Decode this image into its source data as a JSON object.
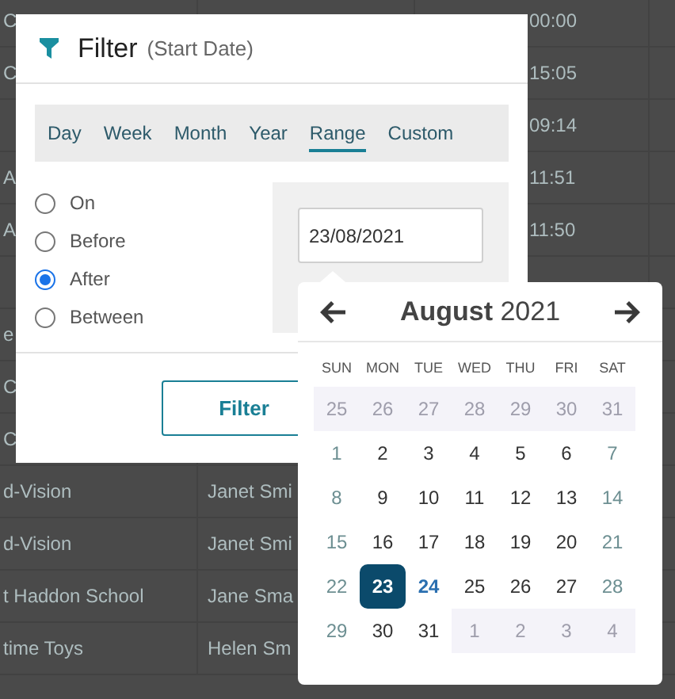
{
  "table": {
    "rows": [
      {
        "cells": [
          "C",
          "",
          "00:00"
        ]
      },
      {
        "cells": [
          "C",
          "",
          "15:05"
        ]
      },
      {
        "cells": [
          "",
          "",
          "09:14"
        ]
      },
      {
        "cells": [
          "A",
          "",
          "11:51"
        ]
      },
      {
        "cells": [
          "A",
          "",
          "11:50"
        ]
      },
      {
        "cells": [
          "",
          "",
          ""
        ]
      },
      {
        "cells": [
          "e",
          "",
          ""
        ]
      },
      {
        "cells": [
          "C",
          "",
          ""
        ]
      },
      {
        "cells": [
          "C",
          "",
          ""
        ]
      },
      {
        "cells": [
          "d-Vision",
          "Janet Smi",
          ""
        ]
      },
      {
        "cells": [
          "d-Vision",
          "Janet Smi",
          ""
        ]
      },
      {
        "cells": [
          "t Haddon School",
          "Jane Sma",
          ""
        ]
      },
      {
        "cells": [
          "time Toys",
          "Helen Sm",
          ""
        ]
      }
    ]
  },
  "dialog": {
    "title": "Filter",
    "subtitle": "(Start Date)",
    "tabs": [
      {
        "label": "Day",
        "selected": false
      },
      {
        "label": "Week",
        "selected": false
      },
      {
        "label": "Month",
        "selected": false
      },
      {
        "label": "Year",
        "selected": false
      },
      {
        "label": "Range",
        "selected": true
      },
      {
        "label": "Custom",
        "selected": false
      }
    ],
    "options": [
      {
        "label": "On",
        "selected": false
      },
      {
        "label": "Before",
        "selected": false
      },
      {
        "label": "After",
        "selected": true
      },
      {
        "label": "Between",
        "selected": false
      }
    ],
    "date_field": {
      "value": "23/08/2021"
    },
    "buttons": [
      "Filter"
    ]
  },
  "calendar": {
    "month": "August",
    "year": "2021",
    "weekdays": [
      "SUN",
      "MON",
      "TUE",
      "WED",
      "THU",
      "FRI",
      "SAT"
    ],
    "weeks": [
      [
        {
          "day": "25",
          "kind": "other"
        },
        {
          "day": "26",
          "kind": "other"
        },
        {
          "day": "27",
          "kind": "other"
        },
        {
          "day": "28",
          "kind": "other"
        },
        {
          "day": "29",
          "kind": "other"
        },
        {
          "day": "30",
          "kind": "other"
        },
        {
          "day": "31",
          "kind": "other"
        }
      ],
      [
        {
          "day": "1",
          "kind": "current",
          "selected": false,
          "today": false
        },
        {
          "day": "2",
          "kind": "current",
          "selected": false,
          "today": false
        },
        {
          "day": "3",
          "kind": "current",
          "selected": false,
          "today": false
        },
        {
          "day": "4",
          "kind": "current",
          "selected": false,
          "today": false
        },
        {
          "day": "5",
          "kind": "current",
          "selected": false,
          "today": false
        },
        {
          "day": "6",
          "kind": "current",
          "selected": false,
          "today": false
        },
        {
          "day": "7",
          "kind": "current",
          "selected": false,
          "today": false
        }
      ],
      [
        {
          "day": "8",
          "kind": "current",
          "selected": false,
          "today": false
        },
        {
          "day": "9",
          "kind": "current",
          "selected": false,
          "today": false
        },
        {
          "day": "10",
          "kind": "current",
          "selected": false,
          "today": false
        },
        {
          "day": "11",
          "kind": "current",
          "selected": false,
          "today": false
        },
        {
          "day": "12",
          "kind": "current",
          "selected": false,
          "today": false
        },
        {
          "day": "13",
          "kind": "current",
          "selected": false,
          "today": false
        },
        {
          "day": "14",
          "kind": "current",
          "selected": false,
          "today": false
        }
      ],
      [
        {
          "day": "15",
          "kind": "current",
          "selected": false,
          "today": false
        },
        {
          "day": "16",
          "kind": "current",
          "selected": false,
          "today": false
        },
        {
          "day": "17",
          "kind": "current",
          "selected": false,
          "today": false
        },
        {
          "day": "18",
          "kind": "current",
          "selected": false,
          "today": false
        },
        {
          "day": "19",
          "kind": "current",
          "selected": false,
          "today": false
        },
        {
          "day": "20",
          "kind": "current",
          "selected": false,
          "today": false
        },
        {
          "day": "21",
          "kind": "current",
          "selected": false,
          "today": false
        }
      ],
      [
        {
          "day": "22",
          "kind": "current",
          "selected": false,
          "today": false
        },
        {
          "day": "23",
          "kind": "current",
          "selected": true,
          "today": false
        },
        {
          "day": "24",
          "kind": "current",
          "selected": false,
          "today": true
        },
        {
          "day": "25",
          "kind": "current",
          "selected": false,
          "today": false
        },
        {
          "day": "26",
          "kind": "current",
          "selected": false,
          "today": false
        },
        {
          "day": "27",
          "kind": "current",
          "selected": false,
          "today": false
        },
        {
          "day": "28",
          "kind": "current",
          "selected": false,
          "today": false
        }
      ],
      [
        {
          "day": "29",
          "kind": "current",
          "selected": false,
          "today": false
        },
        {
          "day": "30",
          "kind": "current",
          "selected": false,
          "today": false
        },
        {
          "day": "31",
          "kind": "current",
          "selected": false,
          "today": false
        },
        {
          "day": "1",
          "kind": "other"
        },
        {
          "day": "2",
          "kind": "other"
        },
        {
          "day": "3",
          "kind": "other"
        },
        {
          "day": "4",
          "kind": "other"
        }
      ]
    ]
  }
}
